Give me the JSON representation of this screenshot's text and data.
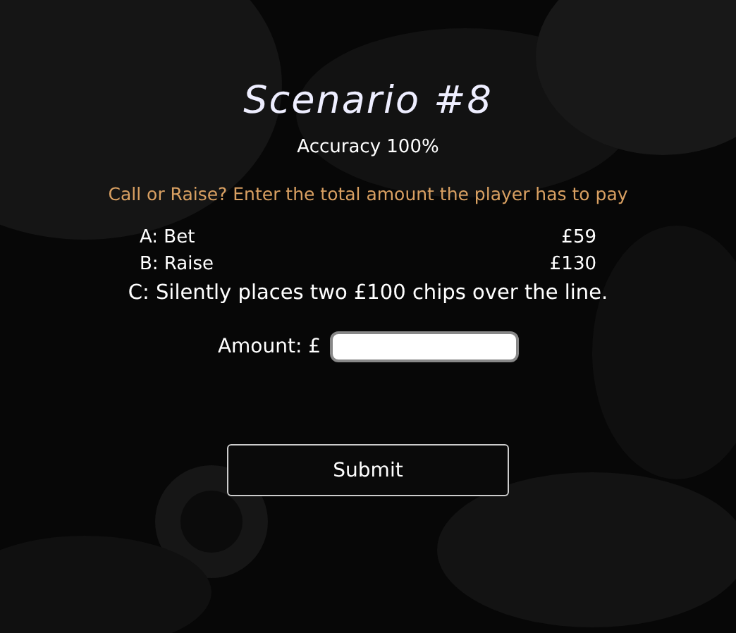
{
  "title": "Scenario #8",
  "accuracy": "Accuracy 100%",
  "question": "Call or Raise? Enter the total amount the player has to pay",
  "actions": [
    {
      "label": "A: Bet",
      "amount": "£59"
    },
    {
      "label": "B: Raise",
      "amount": "£130"
    }
  ],
  "note": "C: Silently places two £100 chips over the line.",
  "amount_label": "Amount: £",
  "submit": "Submit"
}
